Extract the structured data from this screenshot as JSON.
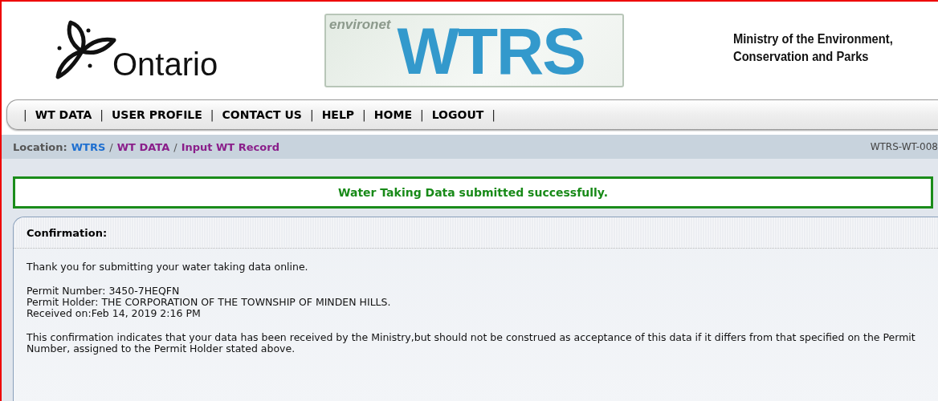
{
  "header": {
    "logo_text": "Ontario",
    "banner": {
      "small": "environet",
      "large": "WTRS"
    },
    "ministry": [
      "Ministry of the Environment,",
      "Conservation and Parks"
    ]
  },
  "nav": [
    {
      "kind": "separator",
      "text": "|"
    },
    {
      "kind": "link",
      "text": "WT DATA"
    },
    {
      "kind": "separator",
      "text": "|"
    },
    {
      "kind": "link",
      "text": "USER PROFILE"
    },
    {
      "kind": "separator",
      "text": "|"
    },
    {
      "kind": "link",
      "text": "CONTACT US"
    },
    {
      "kind": "separator",
      "text": "|"
    },
    {
      "kind": "link",
      "text": "HELP"
    },
    {
      "kind": "separator",
      "text": "|"
    },
    {
      "kind": "link",
      "text": "HOME"
    },
    {
      "kind": "separator",
      "text": "|"
    },
    {
      "kind": "link",
      "text": "LOGOUT"
    },
    {
      "kind": "separator",
      "text": "|"
    }
  ],
  "breadcrumb": {
    "label": "Location:",
    "items": [
      {
        "kind": "link",
        "text": "WTRS",
        "visited": false
      },
      {
        "kind": "separator",
        "text": "/"
      },
      {
        "kind": "link",
        "text": "WT DATA",
        "visited": true
      },
      {
        "kind": "separator",
        "text": "/"
      },
      {
        "kind": "link",
        "text": "Input WT Record",
        "visited": true
      }
    ],
    "page_code": "WTRS-WT-008"
  },
  "message": "Water Taking Data submitted successfully.",
  "panel": {
    "title": "Confirmation:",
    "intro": "Thank you for submitting your water taking data online.",
    "details": [
      "Permit Number: 3450-7HEQFN",
      "Permit Holder: THE CORPORATION OF THE TOWNSHIP OF MINDEN HILLS.",
      "Received on:Feb 14, 2019 2:16 PM"
    ],
    "note": "This confirmation indicates that your data has been received by the Ministry,but should not be construed as acceptance of this data if it differs from that specified on the Permit Number, assigned to the Permit Holder stated above."
  }
}
